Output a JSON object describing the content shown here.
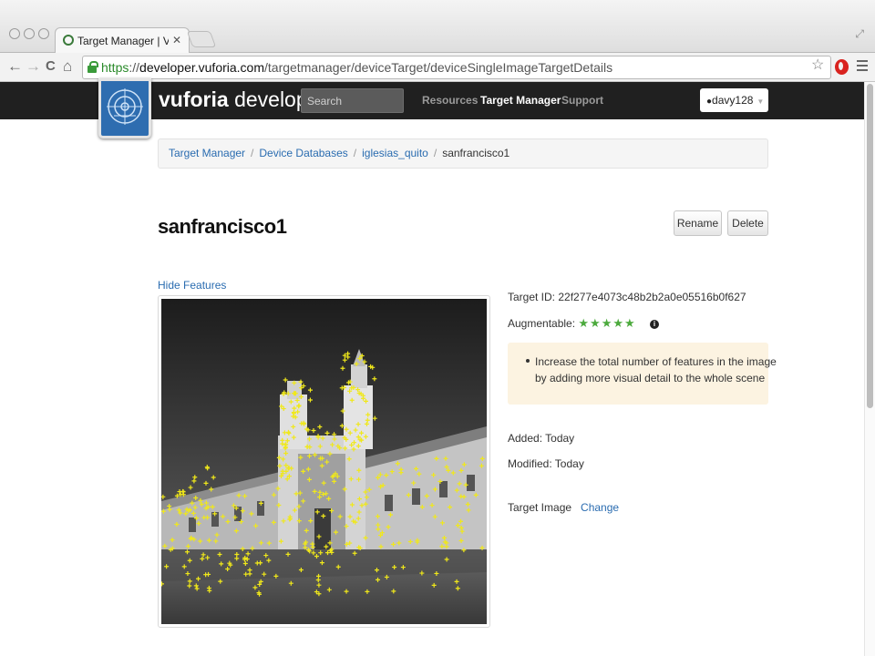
{
  "browser": {
    "tab_title": "Target Manager | Vuforia Developer Portal",
    "tab_close": "✕",
    "url_scheme": "https",
    "url_sep": "://",
    "url_host": "developer.vuforia.com",
    "url_path": "/targetmanager/deviceTarget/deviceSingleImageTargetDetails",
    "nav": {
      "back": "←",
      "forward": "→",
      "reload": "C",
      "home": "⌂"
    },
    "star": "☆",
    "resize": "⤢"
  },
  "site": {
    "brand_bold": "vuforia",
    "brand_light": " developer",
    "search_placeholder": "Search",
    "nav_links": [
      "Resources",
      "Target Manager",
      "Support"
    ],
    "active_nav": "Target Manager",
    "user": "davy128",
    "user_icon": "👤",
    "caret": "▼"
  },
  "breadcrumb": {
    "items": [
      "Target Manager",
      "Device Databases",
      "iglesias_quito"
    ],
    "separator": "/",
    "current": "sanfrancisco1"
  },
  "page": {
    "title": "sanfrancisco1",
    "rename_label": "Rename",
    "delete_label": "Delete",
    "hide_features_label": "Hide Features"
  },
  "details": {
    "target_id": "Target ID: 22f277e4073c48b2b2a0e05516b0f627",
    "augmentable_label": "Augmentable:",
    "augmentable_rating": 5,
    "augmentable_max": 5,
    "stars": "★★★★★",
    "info_icon": "i",
    "tip_line1": "Increase the total number of features in the image",
    "tip_line2": "by adding more visual detail to the whole scene",
    "added": "Added: Today",
    "modified": "Modified: Today",
    "target_image_label": "Target Image",
    "change_label": "Change"
  },
  "colors": {
    "link": "#2a6cb0",
    "star_green": "#4caa3d",
    "feature_marker": "#f0e81a",
    "header_bg": "#202020",
    "tip_bg": "#fcf3e1"
  }
}
